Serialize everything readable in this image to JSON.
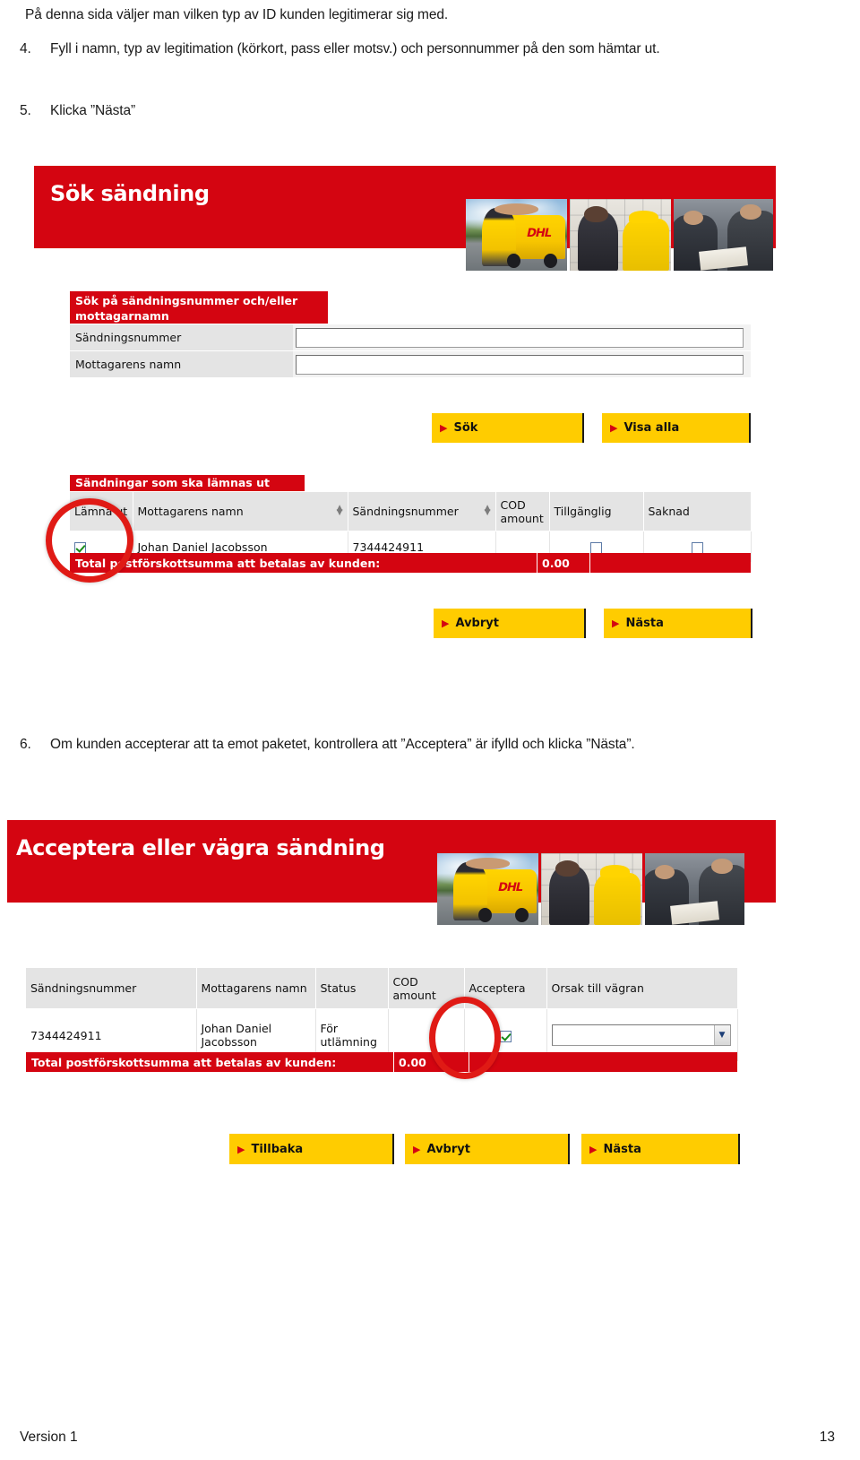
{
  "document": {
    "intro": "På denna sida väljer man vilken typ av ID kunden legitimerar sig med.",
    "steps": [
      {
        "num": "4.",
        "text": "Fyll i namn, typ av legitimation (körkort, pass eller motsv.) och personnummer på den som hämtar ut."
      },
      {
        "num": "5.",
        "text": "Klicka ”Nästa”"
      },
      {
        "num": "6.",
        "text": "Om kunden accepterar att ta emot paketet, kontrollera att ”Acceptera” är ifylld och klicka ”Nästa”."
      }
    ],
    "footer": {
      "version": "Version 1",
      "page": "13"
    }
  },
  "colors": {
    "dhl_red": "#d40511",
    "dhl_yellow": "#ffcc00",
    "annotation_red": "#e01a15",
    "header_grey": "#e4e4e4"
  },
  "screen_search": {
    "banner_title": "Sök sändning",
    "photos": [
      "dhl-courier-van-photo",
      "dhl-counter-service-photo",
      "dhl-business-meeting-photo"
    ],
    "search_panel": {
      "heading": "Sök på sändningsnummer och/eller mottagarnamn",
      "fields": [
        {
          "label": "Sändningsnummer",
          "value": "",
          "placeholder": ""
        },
        {
          "label": "Mottagarens namn",
          "value": "",
          "placeholder": ""
        }
      ]
    },
    "search_buttons": [
      {
        "label": "Sök",
        "name": "search-button"
      },
      {
        "label": "Visa alla",
        "name": "show-all-button"
      }
    ],
    "results": {
      "heading": "Sändningar som ska lämnas ut",
      "columns": [
        "Lämna ut",
        "Mottagarens namn",
        "Sändningsnummer",
        "COD amount",
        "Tillgänglig",
        "Saknad"
      ],
      "sortable_columns": [
        "Mottagarens namn",
        "Sändningsnummer"
      ],
      "rows": [
        {
          "lamna_ut_checked": true,
          "mottagarens_namn": "Johan Daniel Jacobsson",
          "sandningsnummer": "7344424911",
          "cod_amount": "",
          "tillganglig_checked": false,
          "saknad_checked": false
        }
      ],
      "total_label": "Total postförskottsumma att betalas av kunden:",
      "total_value": "0.00"
    },
    "footer_buttons": [
      {
        "label": "Avbryt",
        "name": "cancel-button"
      },
      {
        "label": "Nästa",
        "name": "next-button"
      }
    ],
    "annotation": "red-oval-highlight-lamna-ut-checkbox"
  },
  "screen_accept": {
    "banner_title": "Acceptera eller vägra sändning",
    "photos": [
      "dhl-courier-van-photo",
      "dhl-counter-service-photo",
      "dhl-business-meeting-photo"
    ],
    "table": {
      "columns": [
        "Sändningsnummer",
        "Mottagarens namn",
        "Status",
        "COD amount",
        "Acceptera",
        "Orsak till vägran"
      ],
      "rows": [
        {
          "sandningsnummer": "7344424911",
          "mottagarens_namn": "Johan Daniel Jacobsson",
          "status": "För utlämning",
          "cod_amount": "",
          "acceptera_checked": true,
          "orsak_till_vagran": ""
        }
      ],
      "total_label": "Total postförskottsumma att betalas av kunden:",
      "total_value": "0.00"
    },
    "footer_buttons": [
      {
        "label": "Tillbaka",
        "name": "back-button"
      },
      {
        "label": "Avbryt",
        "name": "cancel-button"
      },
      {
        "label": "Nästa",
        "name": "next-button"
      }
    ],
    "annotation": "red-oval-highlight-acceptera-checkbox"
  }
}
